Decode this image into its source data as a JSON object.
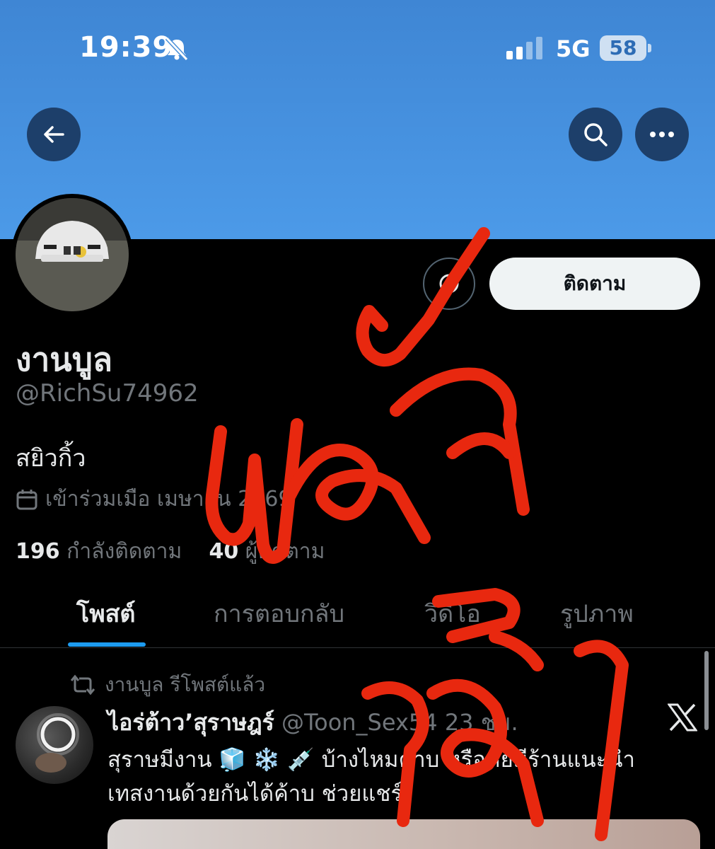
{
  "status_bar": {
    "time": "19:39",
    "network": "5G",
    "battery": "58",
    "icons": [
      "bell-slash-icon",
      "signal-bars-icon",
      "battery-icon"
    ]
  },
  "nav": {
    "icons": [
      "back-arrow-icon",
      "search-icon",
      "more-dots-icon"
    ]
  },
  "profile": {
    "follow_label": "ติดตาม",
    "name": "งานบูล",
    "handle": "@RichSu74962",
    "bio": "สยิวกิ้ว",
    "joined": "เข้าร่วมเมือ เมษายน 2569",
    "following_count": "196",
    "following_label": "กำลังติดตาม",
    "followers_count": "40",
    "followers_label": "ผู้ติดตาม"
  },
  "tabs": [
    {
      "label": "โพสต์"
    },
    {
      "label": "การตอบกลับ"
    },
    {
      "label": "วิดีโอ"
    },
    {
      "label": "รูปภาพ"
    }
  ],
  "post": {
    "repost_label": "งานบูล รีโพสต์แล้ว",
    "author": "ไอร่ต้าว’สุราษฎร์",
    "handle": "@Toon_Sex54",
    "time": "23 ชม.",
    "text_line1": "สุราษมีงาน 🧊 ❄️ 💉 บ้างไหมค่าบ หรือคัยมีร้านแนะนำ",
    "text_line2": "เทสงานด้วยกันได้ค้าบ ช่วยแชร์"
  },
  "overlay": {
    "scribble_text": "หลังลูกนะ",
    "scribble_color": "#e8280f"
  },
  "colors": {
    "banner": "#4c9ae8",
    "accent": "#1d9bf0",
    "muted": "#71767b"
  }
}
